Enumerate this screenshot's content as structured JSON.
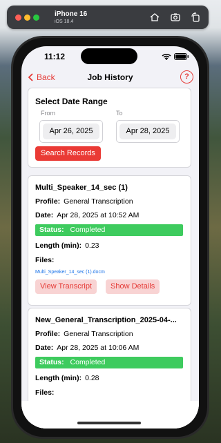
{
  "simulator": {
    "device": "iPhone 16",
    "os": "iOS 18.4"
  },
  "status": {
    "time": "11:12"
  },
  "nav": {
    "back_label": "Back",
    "title": "Job History",
    "help_label": "?"
  },
  "date_range": {
    "heading": "Select Date Range",
    "from_label": "From",
    "to_label": "To",
    "from_value": "Apr 26, 2025",
    "to_value": "Apr 28, 2025",
    "search_label": "Search Records"
  },
  "labels": {
    "profile": "Profile:",
    "date": "Date:",
    "status": "Status:",
    "length": "Length (min):",
    "files": "Files:",
    "view_transcript": "View Transcript",
    "show_details": "Show Details"
  },
  "jobs": [
    {
      "title": "Multi_Speaker_14_sec (1)",
      "profile": "General Transcription",
      "date": "Apr 28, 2025 at 10:52 AM",
      "status": "Completed",
      "length": "0.23",
      "file": "Multi_Speaker_14_sec (1).docm"
    },
    {
      "title": "New_General_Transcription_2025-04-...",
      "profile": "General Transcription",
      "date": "Apr 28, 2025 at 10:06 AM",
      "status": "Completed",
      "length": "0.28"
    }
  ],
  "colors": {
    "accent": "#e53935",
    "status_green": "#3ecb5e",
    "link": "#1a73e8"
  }
}
